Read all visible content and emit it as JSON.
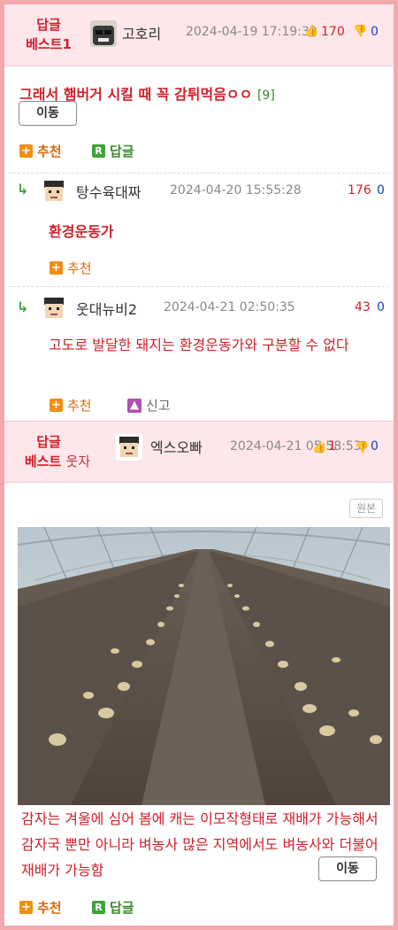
{
  "best1": {
    "label_line1": "답글",
    "label_line2": "베스트1",
    "nickname": "고호리",
    "datetime": "2024-04-19 17:19:30",
    "up_count": "170",
    "down_count": "0",
    "title": "그래서 햄버거 시킬 때 꼭 감튀먹음ㅇㅇ",
    "comment_count": "[9]",
    "move_button": "이동",
    "recommend_label": "추천",
    "reply_label": "답글"
  },
  "replies": [
    {
      "nickname": "탕수육대짜",
      "datetime": "2024-04-20 15:55:28",
      "up_count": "176",
      "down_count": "0",
      "body": "환경운동가",
      "recommend_label": "추천"
    },
    {
      "nickname": "웃대뉴비2",
      "datetime": "2024-04-21 02:50:35",
      "up_count": "43",
      "down_count": "0",
      "body": "고도로 발달한 돼지는 환경운동가와 구분할 수 없다",
      "recommend_label": "추천",
      "report_label": "신고"
    }
  ],
  "best_funny": {
    "label_line1": "답글",
    "label_line2": "베스트",
    "label_sub": "웃자",
    "nickname": "엑스오빠",
    "datetime": "2024-04-21 05:58:53",
    "up_count": "1",
    "down_count": "0",
    "original_button": "원본",
    "body": "감자는 겨울에 심어 봄에 캐는 이모작형태로 재배가 가능해서 감자국 뿐만 아니라 벼농사 많은 지역에서도 벼농사와 더불어 재배가 가능함",
    "move_button": "이동",
    "recommend_label": "추천",
    "reply_label": "답글"
  },
  "icons": {
    "thumb_up": "thumb-up-icon",
    "thumb_down": "thumb-down-icon",
    "plus": "plus-icon",
    "reply": "reply-r-icon",
    "report": "report-icon",
    "reply_arrow": "reply-arrow-icon"
  },
  "colors": {
    "accent_red": "#d0202a",
    "frame_pink": "#f4a7ad",
    "header_pink": "#fde7ea",
    "down_blue": "#1d3fbf",
    "orange": "#f08e14",
    "green": "#3fa33a"
  }
}
